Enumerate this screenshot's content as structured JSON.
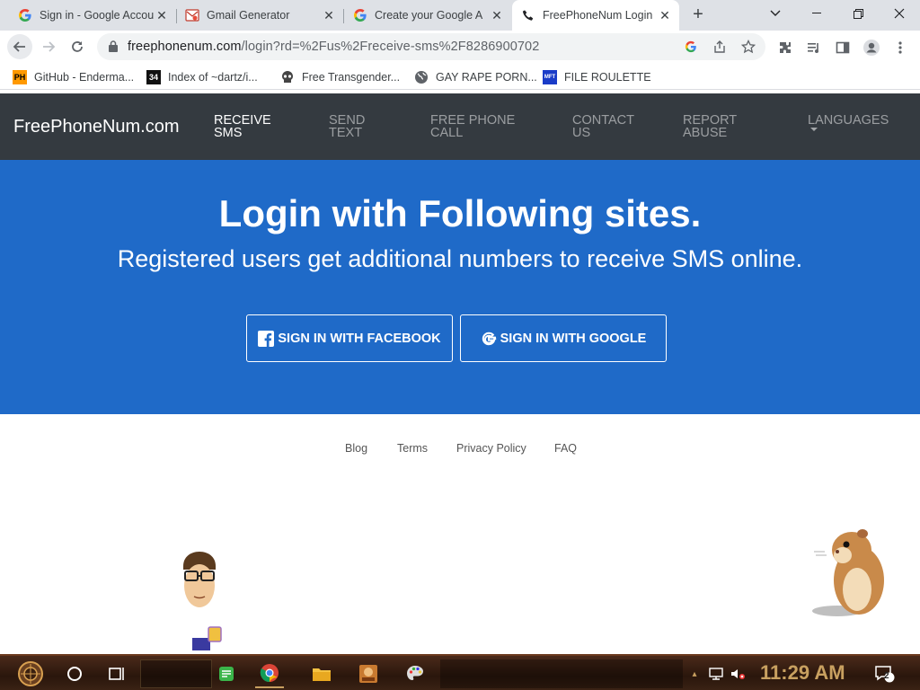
{
  "browser": {
    "tabs": [
      {
        "title": "Sign in - Google Accou",
        "icon": "google-g-icon"
      },
      {
        "title": "Gmail Generator",
        "icon": "gmail-generator-icon"
      },
      {
        "title": "Create your Google A",
        "icon": "google-g-icon"
      },
      {
        "title": "FreePhoneNum Login",
        "icon": "phone-icon",
        "active": true
      }
    ],
    "url_host": "freephonenum.com",
    "url_path": "/login?rd=%2Fus%2Freceive-sms%2F8286900702",
    "bookmarks": [
      {
        "label": "GitHub - Enderma...",
        "icon": "PH"
      },
      {
        "label": "Index of ~dartz/i...",
        "icon": "34"
      },
      {
        "label": "Free Transgender...",
        "icon": "skull-icon"
      },
      {
        "label": "GAY RAPE PORN...",
        "icon": "globe-icon"
      },
      {
        "label": "FILE ROULETTE",
        "icon": "MFT"
      }
    ]
  },
  "site": {
    "brand": "FreePhoneNum.com",
    "nav": [
      {
        "line1": "RECEIVE",
        "line2": "SMS",
        "active": true
      },
      {
        "line1": "SEND",
        "line2": "TEXT"
      },
      {
        "line1": "FREE PHONE",
        "line2": "CALL"
      },
      {
        "line1": "CONTACT",
        "line2": "US"
      },
      {
        "line1": "REPORT",
        "line2": "ABUSE"
      },
      {
        "line1": "LANGUAGES",
        "line2": ""
      }
    ],
    "hero_title": "Login with Following sites.",
    "hero_subtitle": "Registered users get additional numbers to receive SMS online.",
    "facebook_label": "SIGN IN WITH FACEBOOK",
    "google_label": "SIGN IN WITH GOOGLE",
    "footer": [
      "Blog",
      "Terms",
      "Privacy Policy",
      "FAQ"
    ]
  },
  "taskbar": {
    "clock": "11:29 AM",
    "notification_count": "2"
  },
  "colors": {
    "navbar": "#343a40",
    "hero": "#1f6ac8"
  }
}
